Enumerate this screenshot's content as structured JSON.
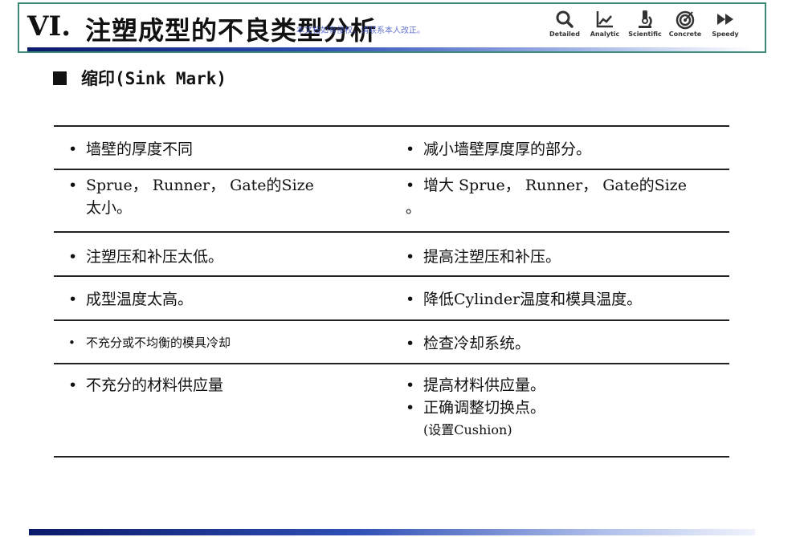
{
  "header": {
    "title_number": "VI.",
    "title_text": "注塑成型的不良类型分析",
    "watermark": "本文档如有侵权，请联系本人改正。",
    "icons": [
      {
        "name": "search-icon",
        "label": "Detailed"
      },
      {
        "name": "chart-icon",
        "label": "Analytic"
      },
      {
        "name": "microscope-icon",
        "label": "Scientific"
      },
      {
        "name": "target-icon",
        "label": "Concrete"
      },
      {
        "name": "fast-forward-icon",
        "label": "Speedy"
      }
    ]
  },
  "section": {
    "title": "缩印(Sink Mark)"
  },
  "rows": [
    {
      "left": [
        {
          "bullet": "•",
          "text": "墙壁的厚度不同"
        }
      ],
      "right": [
        {
          "bullet": "•",
          "text": "减小墙壁厚度厚的部分。"
        }
      ]
    },
    {
      "left": [
        {
          "bullet": "•",
          "text": "Sprue， Runner， Gate的Size"
        },
        {
          "bullet": "",
          "text": "太小。"
        }
      ],
      "right": [
        {
          "bullet": "•",
          "text": "增大 Sprue， Runner， Gate的Size"
        },
        {
          "bullet": "",
          "text": "。"
        }
      ]
    },
    {
      "left": [
        {
          "bullet": "•",
          "text": "注塑压和补压太低。"
        }
      ],
      "right": [
        {
          "bullet": "•",
          "text": "提高注塑压和补压。"
        }
      ]
    },
    {
      "left": [
        {
          "bullet": "•",
          "text": "成型温度太高。"
        }
      ],
      "right": [
        {
          "bullet": "•",
          "text": "降低Cylinder温度和模具温度。"
        }
      ]
    },
    {
      "left": [
        {
          "bullet": "•",
          "text": "不充分或不均衡的模具冷却"
        }
      ],
      "right": [
        {
          "bullet": "•",
          "text": "检查冷却系统。"
        }
      ]
    },
    {
      "left": [
        {
          "bullet": "•",
          "text": "不充分的材料供应量"
        }
      ],
      "right": [
        {
          "bullet": "•",
          "text": "提高材料供应量。"
        },
        {
          "bullet": "•",
          "text": "正确调整切换点。"
        },
        {
          "bullet": "",
          "text": "(设置Cushion)"
        }
      ]
    }
  ]
}
